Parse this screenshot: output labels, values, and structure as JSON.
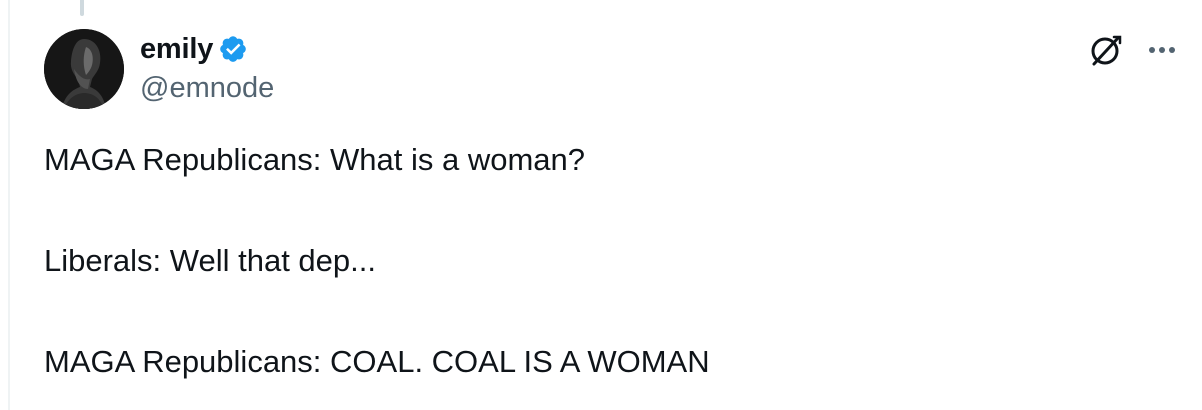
{
  "author": {
    "display_name": "emily",
    "handle": "@emnode",
    "verified": true,
    "avatar": "profile-photo"
  },
  "tweet": {
    "lines": [
      "MAGA Republicans: What is a woman?",
      "Liberals: Well that dep...",
      "MAGA Republicans: COAL. COAL IS A WOMAN"
    ]
  },
  "icons": {
    "verified": "verified-badge-icon",
    "grok": "grok-icon",
    "more": "more-options-icon"
  },
  "colors": {
    "text_primary": "#0f1419",
    "text_secondary": "#536471",
    "verified_blue": "#1d9bf0",
    "border": "#eff3f4"
  }
}
